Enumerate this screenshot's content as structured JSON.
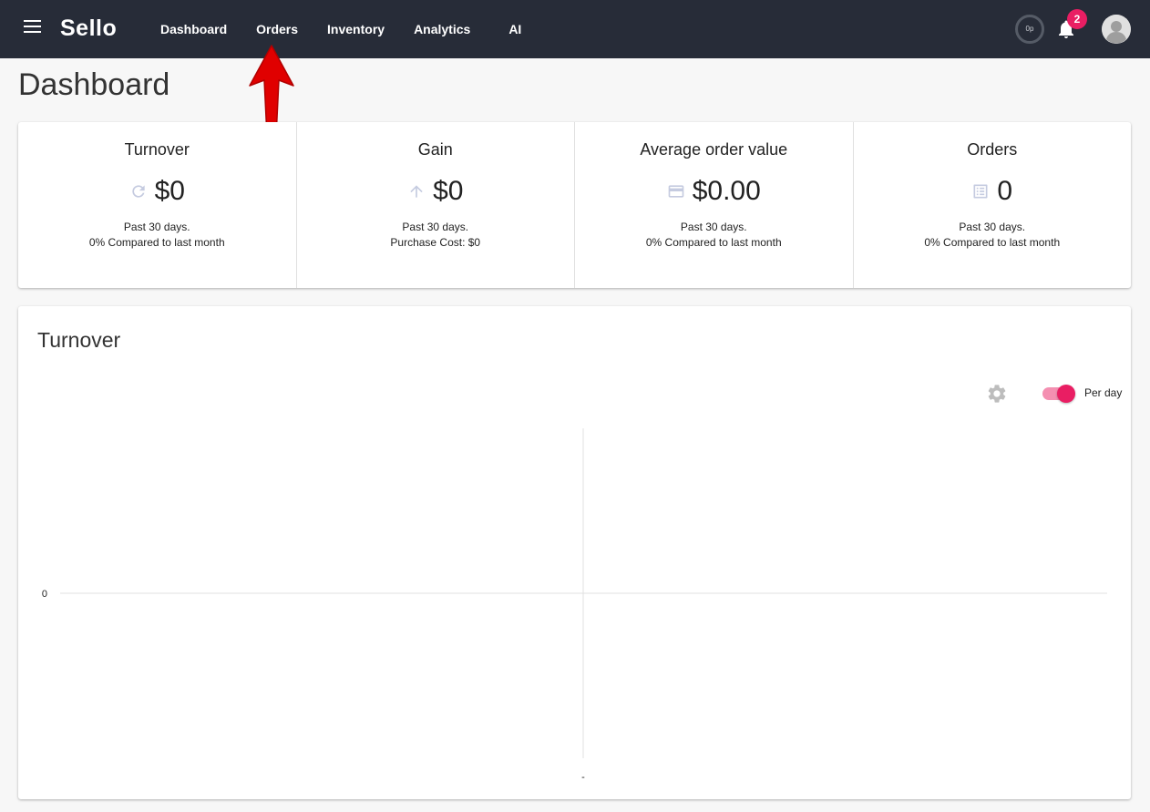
{
  "app": {
    "logo": "Sello"
  },
  "nav": {
    "items": [
      {
        "label": "Dashboard"
      },
      {
        "label": "Orders"
      },
      {
        "label": "Inventory"
      },
      {
        "label": "Analytics"
      },
      {
        "label": "AI"
      }
    ]
  },
  "header": {
    "usage_label": "0p",
    "notifications_count": "2"
  },
  "page": {
    "title": "Dashboard"
  },
  "stats": [
    {
      "label": "Turnover",
      "icon": "refresh-icon",
      "value": "$0",
      "line1": "Past 30 days.",
      "line2": "0% Compared to last month"
    },
    {
      "label": "Gain",
      "icon": "arrow-up-icon",
      "value": "$0",
      "line1": "Past 30 days.",
      "line2": "Purchase Cost: $0"
    },
    {
      "label": "Average order value",
      "icon": "credit-card-icon",
      "value": "$0.00",
      "line1": "Past 30 days.",
      "line2": "0% Compared to last month"
    },
    {
      "label": "Orders",
      "icon": "list-icon",
      "value": "0",
      "line1": "Past 30 days.",
      "line2": "0% Compared to last month"
    }
  ],
  "chart_card": {
    "title": "Turnover",
    "toggle_label": "Per day",
    "toggle_on": true
  },
  "chart_data": {
    "type": "line",
    "title": "Turnover",
    "x": [
      "-"
    ],
    "series": [],
    "yticks": [
      "0"
    ],
    "xticks": [
      "-"
    ],
    "grid": true
  },
  "colors": {
    "topbar": "#272c38",
    "accent": "#e91e63",
    "annotation": "#e00000"
  }
}
